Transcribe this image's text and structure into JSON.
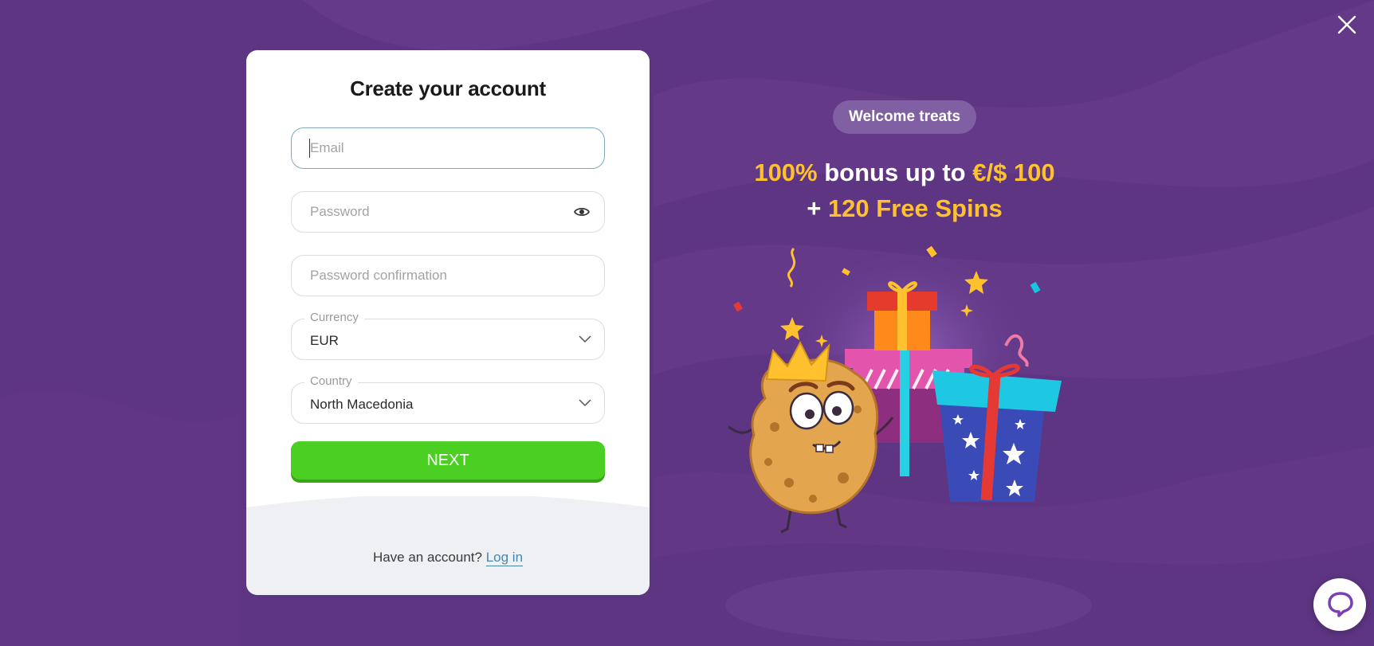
{
  "form": {
    "title": "Create your account",
    "email_placeholder": "Email",
    "password_placeholder": "Password",
    "password_confirmation_placeholder": "Password confirmation",
    "currency": {
      "label": "Currency",
      "value": "EUR"
    },
    "country": {
      "label": "Country",
      "value": "North Macedonia"
    },
    "next_label": "NEXT",
    "have_account_text": "Have an account?",
    "login_link": "Log in"
  },
  "promo": {
    "pill": "Welcome treats",
    "line1_highlight": "100%",
    "line1_text": "bonus up to",
    "line1_amount": "€/$ 100",
    "line2_plus": "+",
    "line2_highlight": "120 Free Spins"
  },
  "colors": {
    "background": "#5e3583",
    "accent_green": "#4ccf23",
    "highlight_yellow": "#ffc22e",
    "link": "#4a86a8"
  },
  "icons": [
    "close-icon",
    "eye-icon",
    "chevron-down-icon",
    "chat-icon"
  ]
}
